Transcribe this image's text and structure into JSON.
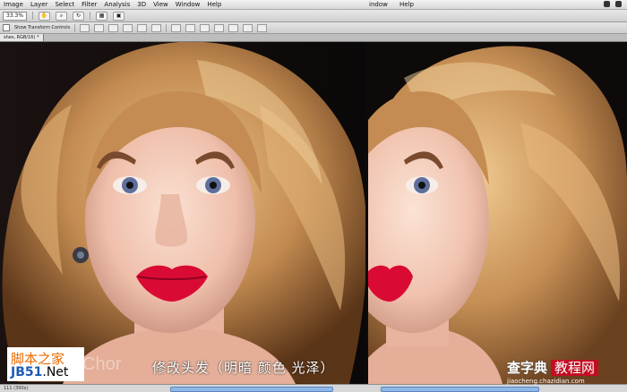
{
  "menu": {
    "items": [
      "Image",
      "Layer",
      "Select",
      "Filter",
      "Analysis",
      "3D",
      "View",
      "Window",
      "Help"
    ],
    "right_window": "indow",
    "right_help": "Help"
  },
  "options_bar": {
    "zoom": "33.3%",
    "show_transform_controls": "Show Transform Controls"
  },
  "document_tab": {
    "label": "shes, RGB/16) *"
  },
  "status": {
    "doc_size": "111 (390x)"
  },
  "overlay": {
    "caption": "修改头发（明暗 颜色 光泽）",
    "chor_text": "Chor",
    "watermark_left_top": "脚本之家",
    "watermark_left_jb": "JB51",
    "watermark_left_net": ".Net",
    "watermark_right_title": "查字典",
    "watermark_right_badge": "教程网",
    "watermark_right_url": "jiaocheng.chazidian.com"
  },
  "colors": {
    "lip": "#d90b34",
    "hair_light": "#e5b77e",
    "hair_dark": "#8a5527",
    "skin": "#f1c4b1",
    "iris": "#5f6f9c",
    "watermark_orange": "#ea6b00",
    "watermark_red": "#c30d23"
  }
}
